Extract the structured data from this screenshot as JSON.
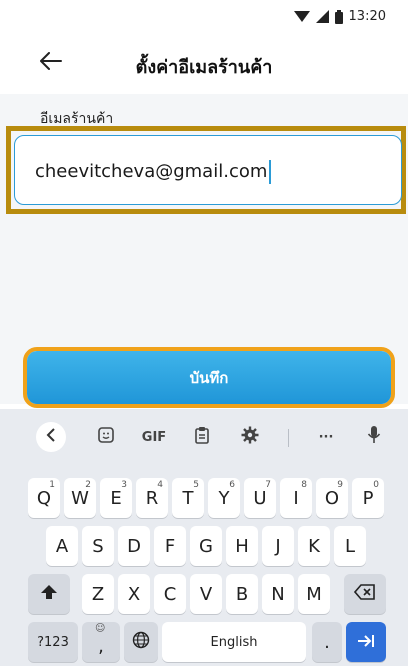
{
  "status": {
    "time": "13:20",
    "icons": [
      "wifi-icon",
      "signal-icon",
      "battery-icon"
    ]
  },
  "header": {
    "title": "ตั้งค่าอีเมลร้านค้า",
    "back_icon": "arrow-left-icon"
  },
  "form": {
    "label": "อีเมลร้านค้า",
    "email_value": "cheevitcheva@gmail.com"
  },
  "save_button": {
    "label": "บันทึก"
  },
  "keyboard": {
    "toolbar": {
      "gif_label": "GIF",
      "more_label": "···"
    },
    "row1": [
      "Q",
      "W",
      "E",
      "R",
      "T",
      "Y",
      "U",
      "I",
      "O",
      "P"
    ],
    "row1_hints": [
      "1",
      "2",
      "3",
      "4",
      "5",
      "6",
      "7",
      "8",
      "9",
      "0"
    ],
    "row2": [
      "A",
      "S",
      "D",
      "F",
      "G",
      "H",
      "J",
      "K",
      "L"
    ],
    "row3": [
      "Z",
      "X",
      "C",
      "V",
      "B",
      "N",
      "M"
    ],
    "symbols_label": "?123",
    "comma_label": ",",
    "space_label": "English",
    "period_label": "."
  },
  "colors": {
    "accent": "#2b9bd6",
    "highlight_input": "#b88c0e",
    "highlight_button": "#f0a21a",
    "enter_key": "#2f6fd9"
  }
}
